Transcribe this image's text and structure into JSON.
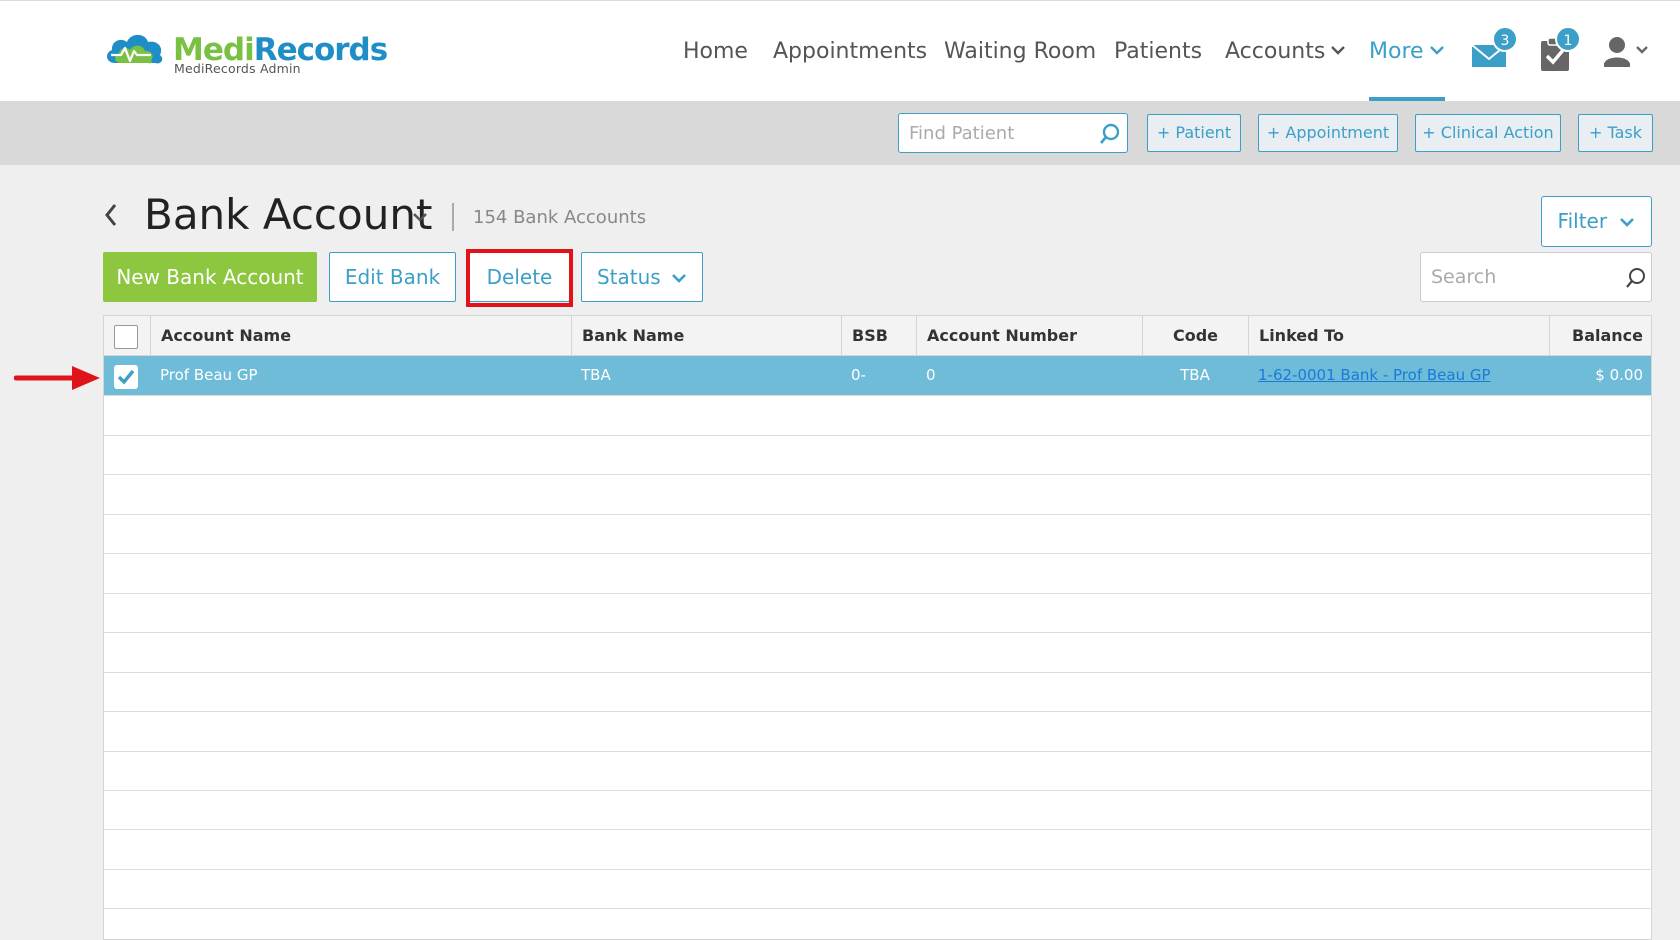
{
  "brand": {
    "name_part1": "Medi",
    "name_part2": "Records",
    "subtitle": "MediRecords Admin"
  },
  "nav": {
    "items": [
      {
        "label": "Home"
      },
      {
        "label": "Appointments"
      },
      {
        "label": "Waiting Room"
      },
      {
        "label": "Patients"
      },
      {
        "label": "Accounts",
        "dropdown": true
      },
      {
        "label": "More",
        "dropdown": true,
        "active": true
      }
    ],
    "messages_badge": "3",
    "tasks_badge": "1",
    "user_icon": "user-icon"
  },
  "toolbar": {
    "find_placeholder": "Find Patient",
    "buttons": [
      "+ Patient",
      "+ Appointment",
      "+ Clinical Action",
      "+ Task"
    ]
  },
  "page": {
    "title": "Bank Account",
    "count_text": "154 Bank Accounts",
    "filter_label": "Filter",
    "search_placeholder": "Search"
  },
  "actions": {
    "new_label": "New Bank Account",
    "edit_label": "Edit Bank",
    "delete_label": "Delete",
    "status_label": "Status"
  },
  "table": {
    "columns": [
      "Account Name",
      "Bank Name",
      "BSB",
      "Account Number",
      "Code",
      "Linked To",
      "Balance"
    ],
    "rows": [
      {
        "selected": true,
        "account_name": "Prof Beau GP",
        "bank_name": "TBA",
        "bsb": "0-",
        "account_number": "0",
        "code": "TBA",
        "linked_to": "1-62-0001 Bank - Prof Beau GP",
        "balance": "$ 0.00"
      }
    ]
  },
  "colors": {
    "accent": "#3b9fc7",
    "primary_button": "#8dc63f",
    "selected_row": "#6fbcd8",
    "highlight": "#e0131a"
  }
}
